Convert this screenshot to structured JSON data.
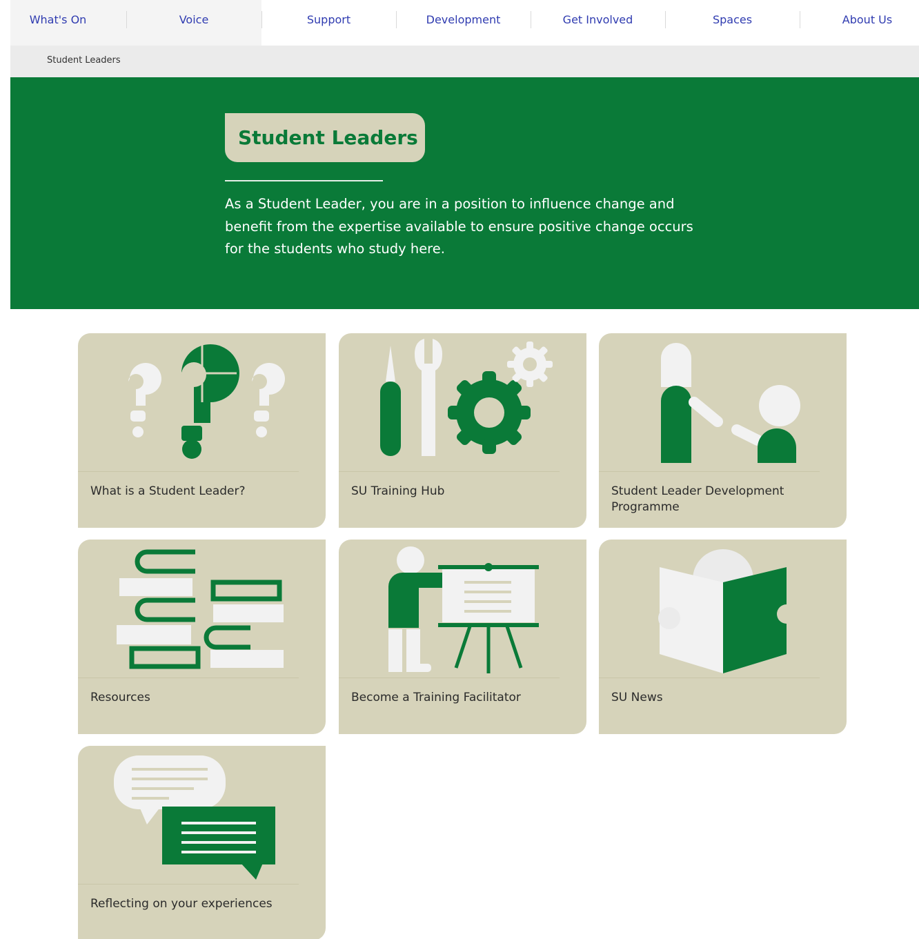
{
  "nav": {
    "items": [
      {
        "label": "What's On"
      },
      {
        "label": "Voice"
      },
      {
        "label": "Support"
      },
      {
        "label": "Development"
      },
      {
        "label": "Get Involved"
      },
      {
        "label": "Spaces"
      },
      {
        "label": "About Us"
      }
    ]
  },
  "breadcrumb": {
    "current": "Student Leaders"
  },
  "hero": {
    "title": "Student Leaders",
    "intro": "As a Student Leader, you are in a position to influence change and benefit from the expertise available to ensure positive change occurs for the students who study here."
  },
  "cards": [
    {
      "label": "What is a Student Leader?",
      "icon": "question-marks-icon"
    },
    {
      "label": "SU Training Hub",
      "icon": "tools-gear-icon"
    },
    {
      "label": "Student Leader Development Programme",
      "icon": "mentor-people-icon"
    },
    {
      "label": "Resources",
      "icon": "book-stack-icon"
    },
    {
      "label": "Become a Training Facilitator",
      "icon": "presenter-board-icon"
    },
    {
      "label": "SU News",
      "icon": "newspaper-reader-icon"
    },
    {
      "label": "Reflecting on your experiences",
      "icon": "speech-bubbles-icon"
    }
  ],
  "colors": {
    "brand_green": "#0a7a38",
    "card_beige": "#d6d3ba",
    "nav_text": "#2f3bb0",
    "icon_white": "#f2f2f2"
  }
}
